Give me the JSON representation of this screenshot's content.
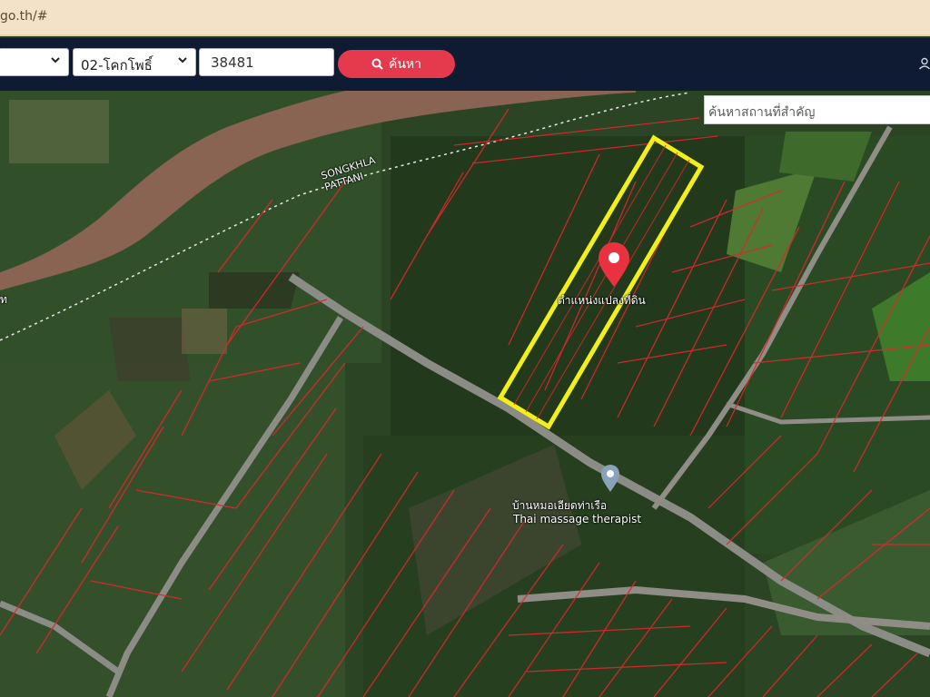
{
  "browser": {
    "url_fragment": "go.th/#"
  },
  "toolbar": {
    "province_value": "",
    "district_value": "02-โคกโพธิ์",
    "parcel_number": "38481",
    "search_button_label": "ค้นหา"
  },
  "map": {
    "place_search_placeholder": "ค้นหาสถานที่สำคัญ",
    "boundary_label_line1": "SONGKHLA",
    "boundary_label_line2": "PATTANI",
    "parcel_pin_label": "ตำแหน่งแปลงที่ดิน",
    "poi_name_th": "บ้านหมอเอียดท่าเรือ",
    "poi_name_en": "Thai massage therapist",
    "edge_label": "ท"
  },
  "colors": {
    "toolbar_bg": "#0f1a33",
    "search_button": "#e53a4d",
    "parcel_highlight": "#f2ef1b",
    "parcel_lines": "#e0262e",
    "pin": "#e8323f"
  },
  "icons": [
    "chevron-down-icon",
    "search-icon",
    "user-icon",
    "map-pin-icon",
    "poi-icon"
  ]
}
